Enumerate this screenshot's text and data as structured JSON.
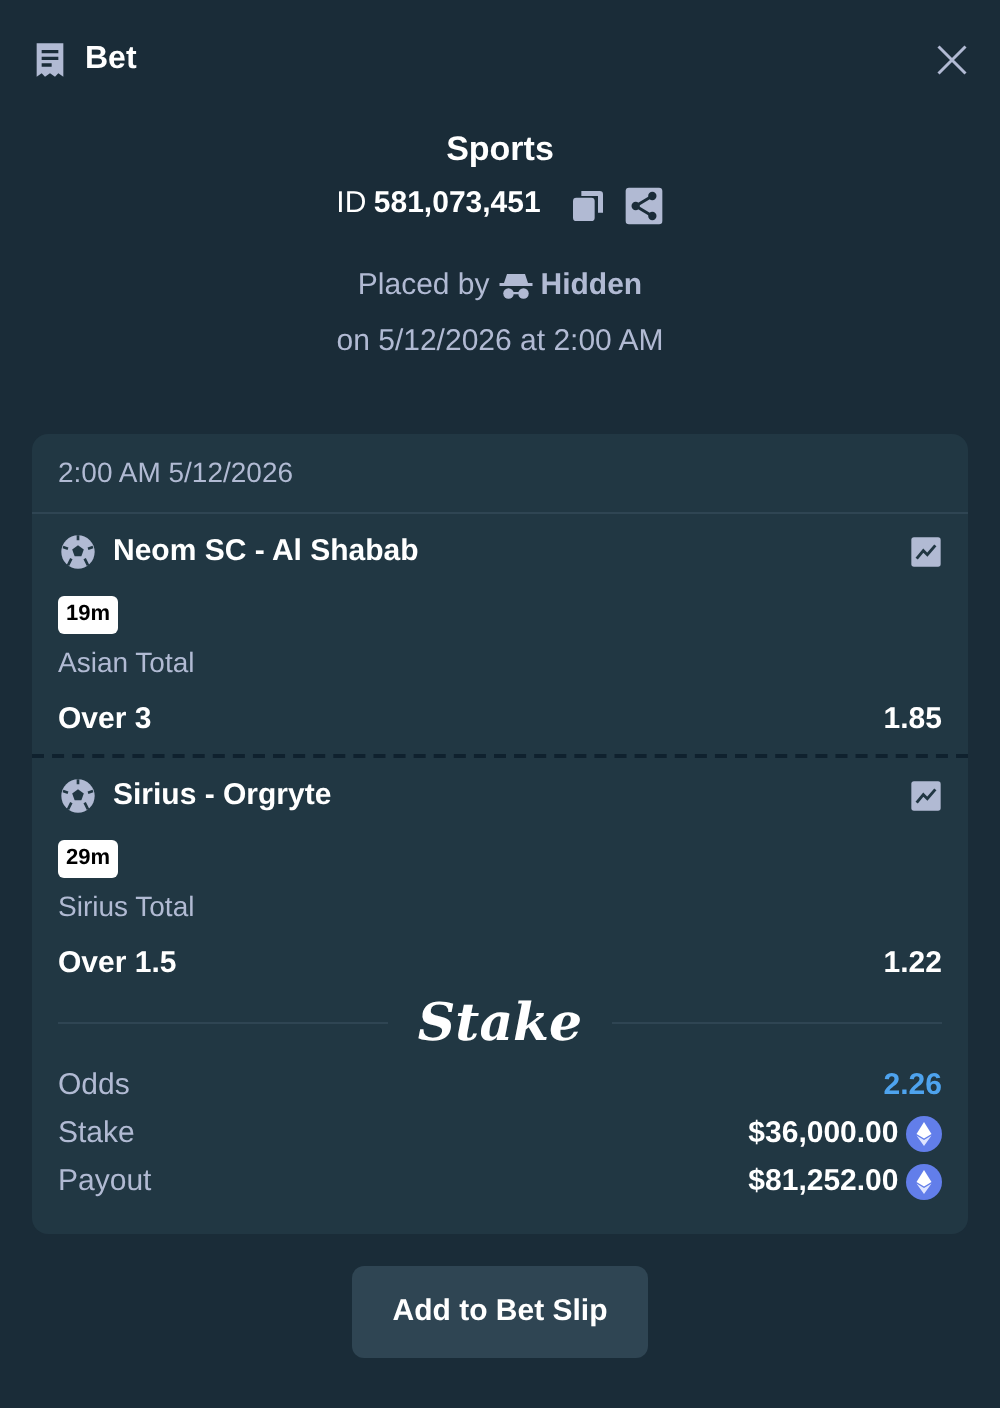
{
  "header": {
    "title": "Bet"
  },
  "bet": {
    "type": "Sports",
    "id_label": "ID",
    "id": "581,073,451",
    "placed_by_label": "Placed by",
    "placed_by": "Hidden",
    "placed_on": "on 5/12/2026 at 2:00 AM"
  },
  "slip": {
    "time": "2:00 AM 5/12/2026",
    "legs": [
      {
        "match": "Neom SC - Al Shabab",
        "clock": "19m",
        "market": "Asian Total",
        "selection": "Over 3",
        "odds": "1.85"
      },
      {
        "match": "Sirius - Orgryte",
        "clock": "29m",
        "market": "Sirius Total",
        "selection": "Over 1.5",
        "odds": "1.22"
      }
    ],
    "brand": "Stake",
    "summary": [
      {
        "label": "Odds",
        "value": "2.26",
        "kind": "odds"
      },
      {
        "label": "Stake",
        "value": "$36,000.00",
        "kind": "amount"
      },
      {
        "label": "Payout",
        "value": "$81,252.00",
        "kind": "amount"
      }
    ]
  },
  "button": "Add to Bet Slip"
}
